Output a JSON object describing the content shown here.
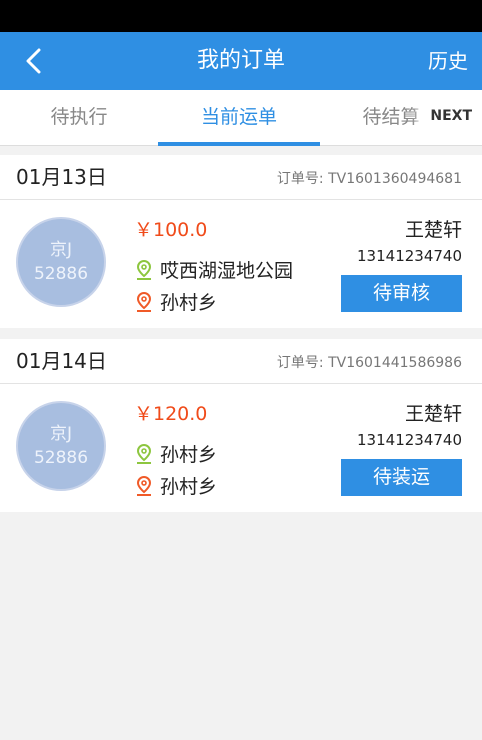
{
  "header": {
    "title": "我的订单",
    "history_label": "历史",
    "back_icon": "chevron-left-icon"
  },
  "tabs": [
    {
      "label": "待执行",
      "active": false
    },
    {
      "label": "当前运单",
      "active": true
    },
    {
      "label": "待结算",
      "active": false
    }
  ],
  "next_label": "NEXT",
  "colors": {
    "primary": "#2f8fe3",
    "price": "#f04b1a",
    "start_pin": "#8dc63f",
    "end_pin": "#f05a28",
    "avatar": "#a8bee0"
  },
  "orders": [
    {
      "date": "01月13日",
      "order_no": "订单号: TV1601360494681",
      "plate_prefix": "京J",
      "plate_number": "52886",
      "price": "￥100.0",
      "start": "哎西湖湿地公园",
      "end": "孙村乡",
      "person": "王楚轩",
      "phone": "13141234740",
      "status": "待审核"
    },
    {
      "date": "01月14日",
      "order_no": "订单号: TV1601441586986",
      "plate_prefix": "京J",
      "plate_number": "52886",
      "price": "￥120.0",
      "start": "孙村乡",
      "end": "孙村乡",
      "person": "王楚轩",
      "phone": "13141234740",
      "status": "待装运"
    }
  ]
}
